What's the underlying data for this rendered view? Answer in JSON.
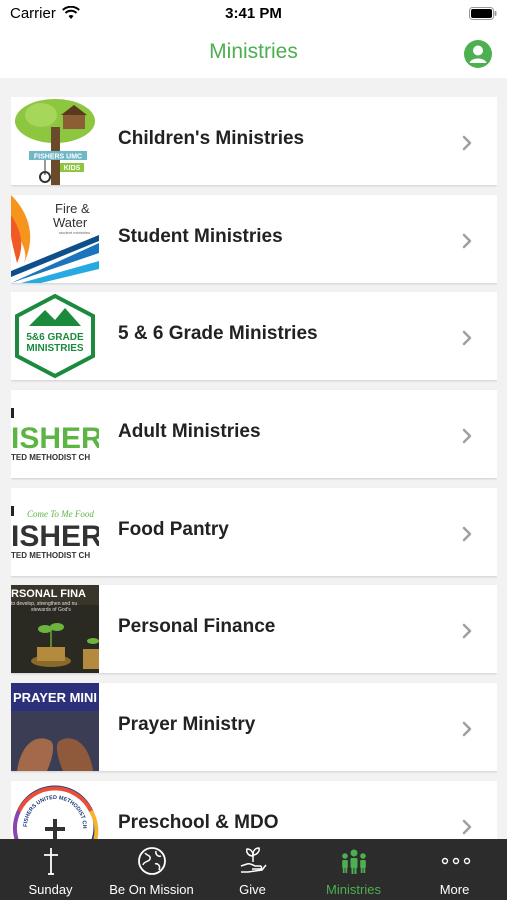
{
  "status": {
    "carrier": "Carrier",
    "time": "3:41 PM"
  },
  "nav": {
    "title": "Ministries"
  },
  "ministries": [
    {
      "label": "Children's Ministries",
      "thumb_text": [
        "FISHERS UMC",
        "KIDS"
      ]
    },
    {
      "label": "Student Ministries",
      "thumb_text": [
        "Fire &",
        "Water",
        "student ministries"
      ]
    },
    {
      "label": "5 & 6 Grade Ministries",
      "thumb_text": [
        "5&6 GRADE",
        "MINISTRIES"
      ]
    },
    {
      "label": "Adult Ministries",
      "thumb_text": [
        "ISHER",
        "TED METHODIST CH"
      ]
    },
    {
      "label": "Food Pantry",
      "thumb_text": [
        "Come To Me Food",
        "ISHER",
        "TED METHODIST CH"
      ]
    },
    {
      "label": "Personal Finance",
      "thumb_text": [
        "RSONAL FINA",
        "to develop, strengthen and nu",
        "stewards of God's"
      ]
    },
    {
      "label": "Prayer Ministry",
      "thumb_text": [
        "PRAYER MINI"
      ]
    },
    {
      "label": "Preschool & MDO",
      "thumb_text": [
        "FISHERS UNITED METHODIST CHURCH"
      ]
    }
  ],
  "tabs": [
    {
      "label": "Sunday",
      "icon": "cross-icon"
    },
    {
      "label": "Be On Mission",
      "icon": "globe-icon"
    },
    {
      "label": "Give",
      "icon": "hand-plant-icon"
    },
    {
      "label": "Ministries",
      "icon": "people-icon"
    },
    {
      "label": "More",
      "icon": "more-dots-icon"
    }
  ],
  "colors": {
    "accent": "#4caf50",
    "tab_bar": "#2c2c2c",
    "background": "#f2f2f2"
  }
}
